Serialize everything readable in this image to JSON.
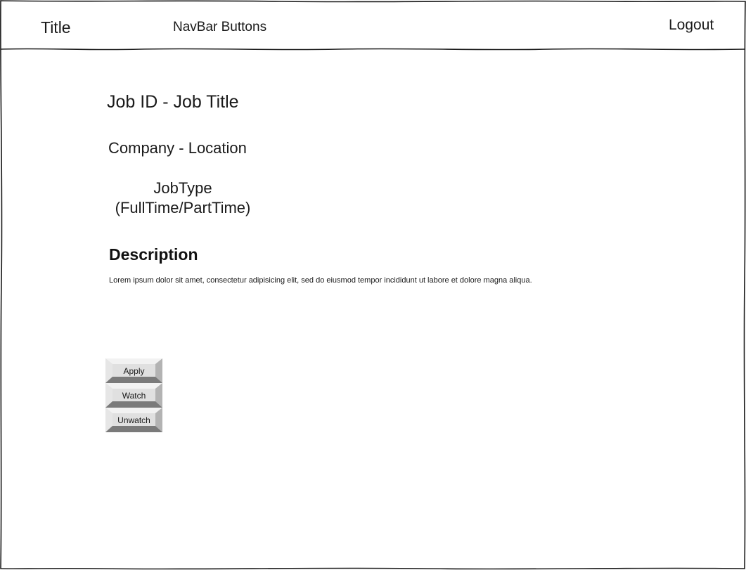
{
  "navbar": {
    "title": "Title",
    "buttons_label": "NavBar Buttons",
    "logout_label": "Logout"
  },
  "job": {
    "title_line": "Job ID - Job Title",
    "company_location": "Company - Location",
    "job_type_line1": "JobType",
    "job_type_line2": "(FullTime/PartTime)",
    "description_heading": "Description",
    "description_text": "Lorem ipsum dolor sit amet, consectetur adipisicing elit, sed do eiusmod tempor incididunt ut labore et dolore magna aliqua."
  },
  "actions": {
    "apply_label": "Apply",
    "watch_label": "Watch",
    "unwatch_label": "Unwatch"
  }
}
